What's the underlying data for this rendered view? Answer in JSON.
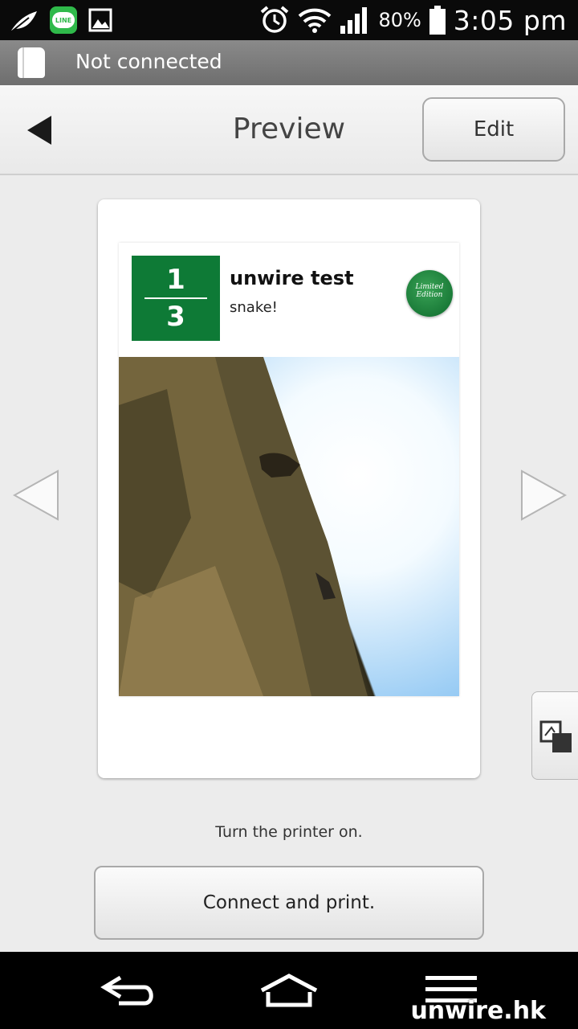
{
  "status_bar": {
    "battery_percent": "80%",
    "time": "3:05 pm",
    "line_label": "LINE",
    "icons": [
      "leaf-icon",
      "line-app-icon",
      "gallery-icon",
      "alarm-icon",
      "wifi-icon",
      "signal-icon",
      "battery-icon"
    ]
  },
  "connection": {
    "status_text": "Not connected",
    "icon": "printer-icon"
  },
  "header": {
    "title": "Preview",
    "edit_label": "Edit",
    "back_icon": "back-triangle-icon"
  },
  "card": {
    "page_current": "1",
    "page_total": "3",
    "title": "unwire test",
    "subtitle": "snake!",
    "seal_line1": "Limited",
    "seal_line2": "Edition",
    "badge_color": "#0e7a36"
  },
  "hint_text": "Turn the printer on.",
  "connect_button_label": "Connect and print.",
  "navbar": {
    "icons": [
      "back-icon",
      "home-icon",
      "menu-icon"
    ]
  },
  "watermark": "unwire.hk"
}
